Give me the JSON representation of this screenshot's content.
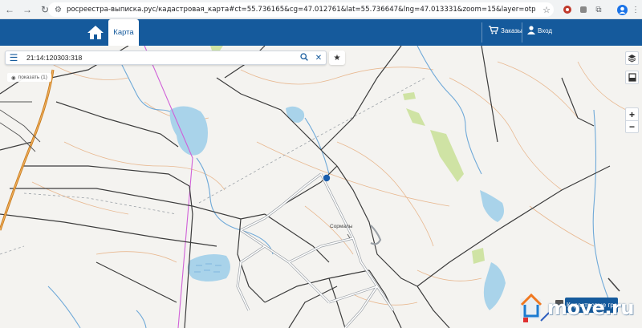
{
  "browser": {
    "url": "росреестра-выписка.рус/кадастровая_карта#ct=55.736165&cg=47.012761&lat=55.736647&lng=47.013331&zoom=15&layer=otp"
  },
  "header": {
    "map_tab": "Карта",
    "orders_label": "Заказы",
    "login_label": "Вход"
  },
  "search": {
    "value": "21:14:120303:318"
  },
  "map": {
    "show_label": "показать (1)",
    "place_label": "Сормалы",
    "zoom_in": "+",
    "zoom_out": "−",
    "boundaries_label": "Кадастровые границы"
  },
  "watermark": {
    "text": "move.ru"
  },
  "colors": {
    "header": "#155a9c",
    "water": "#a9d3ea",
    "forest": "#cfe3a4",
    "marker": "#1b5fae"
  }
}
